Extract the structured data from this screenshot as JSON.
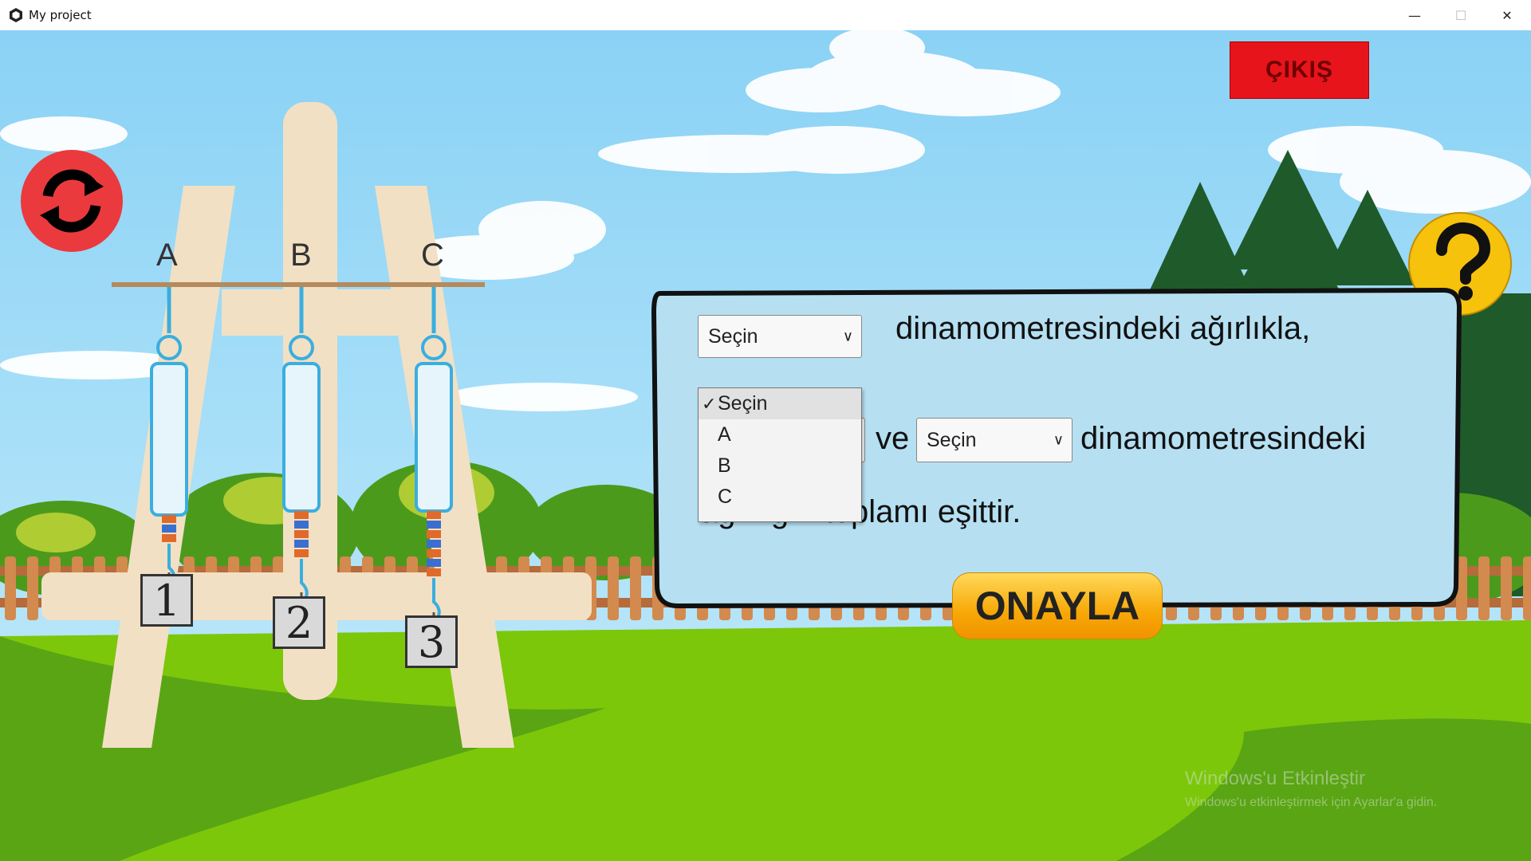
{
  "window": {
    "title": "My project",
    "minimize_glyph": "—",
    "maximize_glyph": "☐",
    "close_glyph": "✕"
  },
  "buttons": {
    "exit_label": "ÇIKIŞ",
    "confirm_label": "ONAYLA",
    "refresh_icon": "refresh-icon",
    "help_icon": "question-icon"
  },
  "rig": {
    "dynamometers": [
      "A",
      "B",
      "C"
    ],
    "weights": [
      "1",
      "2",
      "3"
    ]
  },
  "question": {
    "line1_suffix": "dinamometresindeki ağırlıkla,",
    "line2_middle": "ve",
    "line2_suffix": "dinamometresindeki",
    "line3": "ağırlığın toplamı eşittir."
  },
  "selects": {
    "first": {
      "value": "Seçin",
      "open": true
    },
    "third": {
      "value": "Seçin"
    },
    "options": [
      "Seçin",
      "A",
      "B",
      "C"
    ],
    "selected_option": "Seçin",
    "check_glyph": "✓"
  },
  "watermark": {
    "title": "Windows'u Etkinleştir",
    "subtitle": "Windows'u etkinleştirmek için Ayarlar'a gidin."
  },
  "colors": {
    "sky": "#8fd3f4",
    "grass": "#7cc70a",
    "panel": "#b6e0f2",
    "exit": "#e8141b",
    "refresh": "#ea3a3d",
    "help": "#f6c20b"
  }
}
